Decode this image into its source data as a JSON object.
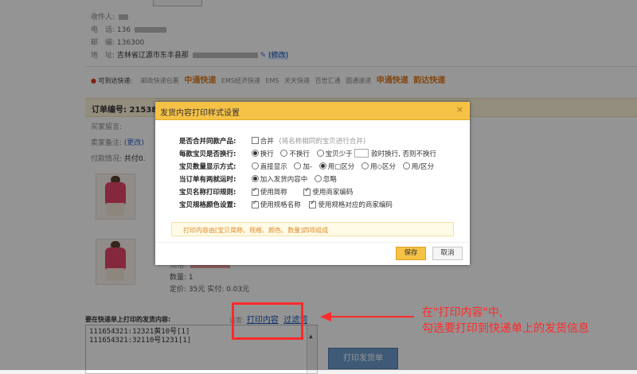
{
  "recipient": {
    "name_label": "收件人:",
    "phone_label": "电　话:",
    "phone_value": "136",
    "zip_label": "邮　编:",
    "zip_value": "136300",
    "address_label": "地　址:",
    "address_value": "吉林省辽源市东丰县那",
    "address_edit": "(修改)"
  },
  "shipping": {
    "label": "可到达快递:",
    "carriers": [
      "邮政快递包裹",
      "中通快递",
      "EMS经济快递",
      "EMS",
      "天天快递",
      "百世汇通",
      "圆通速递",
      "申通快递",
      "韵达快递"
    ]
  },
  "order": {
    "number_label": "订单编号: 21538",
    "buyer_msg_label": "买家留言:",
    "seller_note_label": "卖家备注:",
    "seller_note_edit": "(更改)",
    "payment_label": "付款情况:",
    "payment_value": "共付0.",
    "item": {
      "spec_label": "规格:",
      "quantity": "数量: 1",
      "price": "定价: 35元   实付: 0.03元"
    }
  },
  "dialog": {
    "title": "发货内容打印样式设置",
    "close": "×",
    "rows": [
      {
        "label": "是否合并同款产品:",
        "opts": [
          "合并"
        ],
        "hint": "(将名称相同的宝贝进行合并)"
      },
      {
        "label": "每款宝贝是否换行:",
        "opts": [
          "换行",
          "不换行",
          "宝贝少于",
          "款时换行, 否则不换行"
        ]
      },
      {
        "label": "宝贝数量显示方式:",
        "opts": [
          "直接显示",
          "加-",
          "用□区分",
          "用◇区分",
          "用/区分"
        ]
      },
      {
        "label": "当订单有两就运时:",
        "opts": [
          "加入发货内容中",
          "忽略"
        ]
      },
      {
        "label": "宝贝名称打印规则:",
        "opts": [
          "使用简称",
          "使用商家编码"
        ]
      },
      {
        "label": "宝贝规格颜色设置:",
        "opts": [
          "使用规格名称",
          "使用规格对应的商家编码"
        ]
      }
    ],
    "notice": "打印内容由[宝贝简称、规格、颜色、数量]四项组成",
    "save_label": "保存",
    "cancel_label": "取消"
  },
  "bottom": {
    "print_content_label": "要在快递单上打印的发货内容:",
    "settings_prefix": "设置:",
    "print_content_link": "打印内容",
    "filter_link": "过滤词",
    "textarea_lines": [
      "111654321:12321黄10号[1]",
      "111654321:32110号1231[1]"
    ],
    "print_button": "打印发货单"
  },
  "annotation": {
    "line1": "在\"打印内容\"中,",
    "line2": "勾选要打印到快递单上的发货信息"
  },
  "colors": {
    "dialog_header": "#f6c246",
    "highlight_red": "#ff2a2a",
    "carrier_orange": "#e07a1b",
    "print_button": "#6c9bcb"
  }
}
